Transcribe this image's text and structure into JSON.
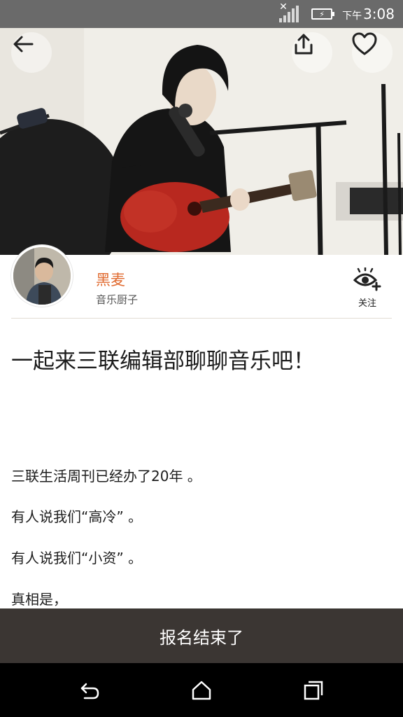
{
  "status_bar": {
    "ampm": "下午",
    "time": "3:08",
    "signal_icon": "signal-no-service-icon",
    "battery_icon": "battery-charging-icon"
  },
  "hero": {
    "back_icon": "arrow-left-icon",
    "share_icon": "share-upload-icon",
    "favorite_icon": "heart-outline-icon"
  },
  "author": {
    "name": "黑麦",
    "description": "音乐厨子",
    "follow_label": "关注",
    "follow_icon": "eye-plus-icon"
  },
  "article": {
    "title": "一起来三联编辑部聊聊音乐吧！",
    "paragraphs": [
      "三联生活周刊已经办了20年 。",
      "有人说我们“高冷” 。",
      "有人说我们“小资” 。",
      "真相是，"
    ]
  },
  "action_bar": {
    "label": "报名结束了"
  },
  "nav_bar": {
    "back_icon": "nav-back-icon",
    "home_icon": "nav-home-icon",
    "recents_icon": "nav-recents-icon"
  },
  "colors": {
    "accent_name": "#e06a2f",
    "action_bar_bg": "#3b3633",
    "status_bar_bg": "#6a6a6a"
  }
}
